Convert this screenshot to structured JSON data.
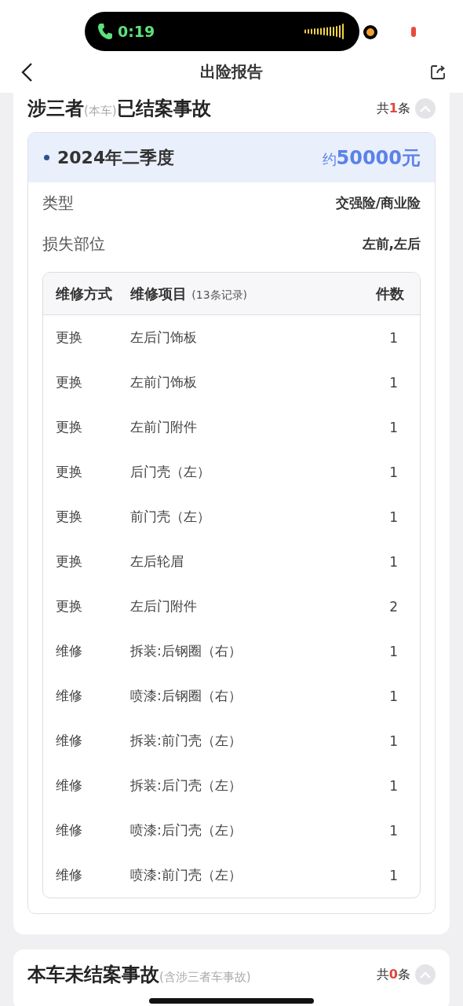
{
  "status_bar": {
    "call_time": "0:19"
  },
  "header": {
    "title": "出险报告"
  },
  "sections": [
    {
      "title_parts": [
        {
          "text": "涉三者",
          "kind": "main"
        },
        {
          "text": "(本车)",
          "kind": "note"
        },
        {
          "text": "已结案事故",
          "kind": "main"
        }
      ],
      "count_parts": [
        {
          "text": "共",
          "kind": "plain"
        },
        {
          "text": "1",
          "kind": "number"
        },
        {
          "text": "条",
          "kind": "plain"
        }
      ],
      "expanded": true,
      "records": [
        {
          "period": "2024年二季度",
          "amount_parts": [
            {
              "text": "约",
              "kind": "prefix"
            },
            {
              "text": "50000元",
              "kind": "value"
            }
          ],
          "details": [
            {
              "label": "类型",
              "value": "交强险/商业险"
            },
            {
              "label": "损失部位",
              "value": "左前,左后"
            }
          ],
          "table": {
            "columns": [
              {
                "label": "维修方式"
              },
              {
                "label": "维修项目",
                "note": "(13条记录)"
              },
              {
                "label": "件数"
              }
            ],
            "rows": [
              [
                "更换",
                "左后门饰板",
                "1"
              ],
              [
                "更换",
                "左前门饰板",
                "1"
              ],
              [
                "更换",
                "左前门附件",
                "1"
              ],
              [
                "更换",
                "后门壳（左）",
                "1"
              ],
              [
                "更换",
                "前门壳（左）",
                "1"
              ],
              [
                "更换",
                "左后轮眉",
                "1"
              ],
              [
                "更换",
                "左后门附件",
                "2"
              ],
              [
                "维修",
                "拆装:后钢圈（右）",
                "1"
              ],
              [
                "维修",
                "喷漆:后钢圈（右）",
                "1"
              ],
              [
                "维修",
                "拆装:前门壳（左）",
                "1"
              ],
              [
                "维修",
                "拆装:后门壳（左）",
                "1"
              ],
              [
                "维修",
                "喷漆:后门壳（左）",
                "1"
              ],
              [
                "维修",
                "喷漆:前门壳（左）",
                "1"
              ]
            ]
          }
        }
      ]
    },
    {
      "title_parts": [
        {
          "text": "本车未结案事故",
          "kind": "main"
        },
        {
          "text": "(含涉三者车事故)",
          "kind": "note"
        }
      ],
      "count_parts": [
        {
          "text": "共",
          "kind": "plain"
        },
        {
          "text": "0",
          "kind": "number"
        },
        {
          "text": "条",
          "kind": "plain"
        }
      ],
      "expanded": true
    }
  ]
}
